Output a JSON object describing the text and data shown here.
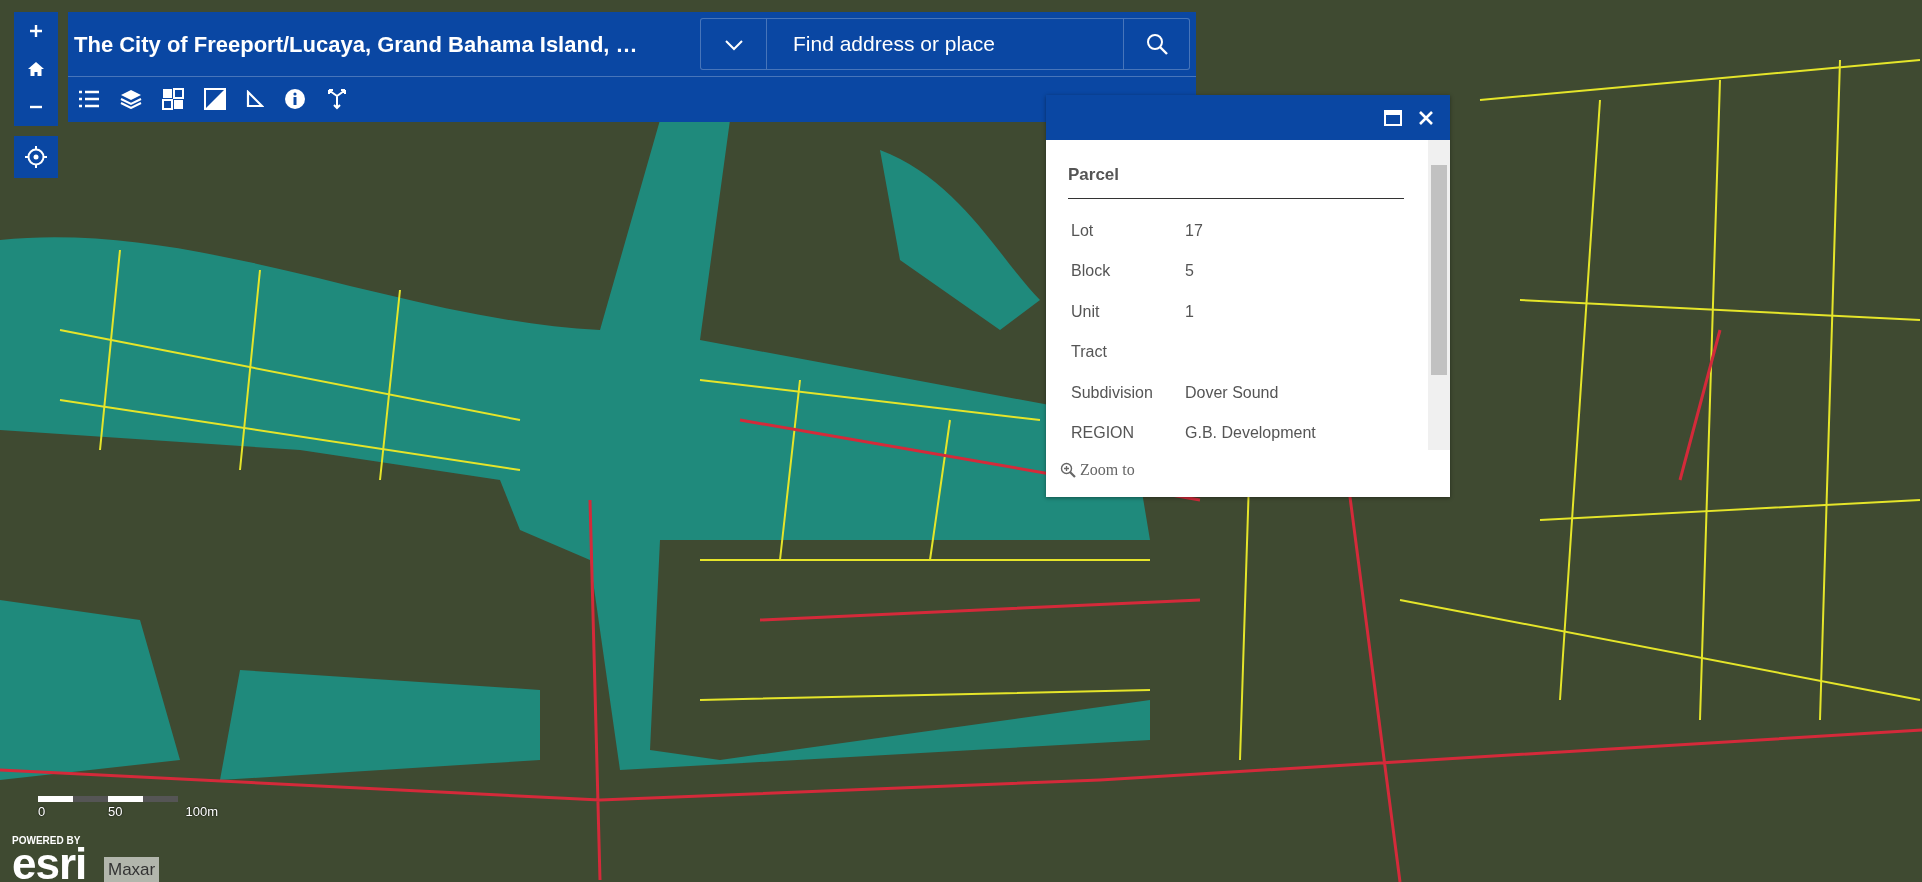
{
  "header": {
    "title": "The City of Freeport/Lucaya, Grand Bahama Island, …",
    "search": {
      "placeholder": "Find address or place"
    }
  },
  "popup": {
    "title": "Parcel",
    "fields": [
      {
        "label": "Lot",
        "value": "17"
      },
      {
        "label": "Block",
        "value": "5"
      },
      {
        "label": "Unit",
        "value": "1"
      },
      {
        "label": "Tract"
      },
      {
        "label": "Subdivision",
        "value": "Dover Sound"
      },
      {
        "label": "REGION",
        "value": "G.B. Development"
      }
    ],
    "action": "Zoom to"
  },
  "scale_bar": {
    "labels": [
      "0",
      "50",
      "100m"
    ]
  },
  "logo": {
    "tagline": "POWERED BY",
    "name": "esri"
  },
  "attribution": "Maxar"
}
